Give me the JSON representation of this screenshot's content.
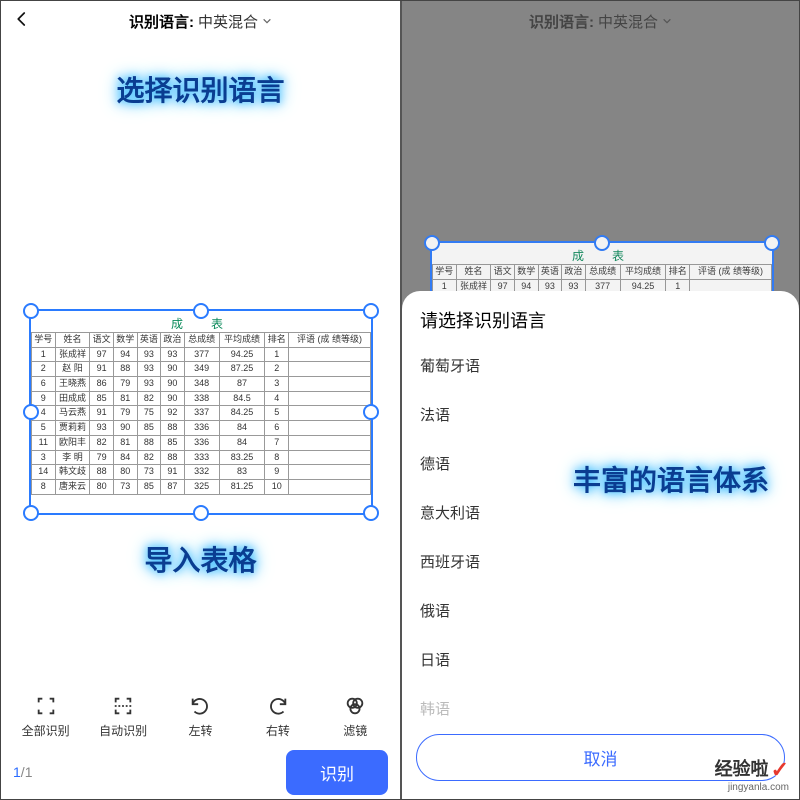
{
  "header": {
    "label": "识别语言:",
    "value": "中英混合"
  },
  "annotations": {
    "select_language": "选择识别语言",
    "import_table": "导入表格",
    "rich_languages": "丰富的语言体系"
  },
  "table": {
    "title": "成　表",
    "columns": [
      "学号",
      "姓名",
      "语文",
      "数学",
      "英语",
      "政治",
      "总成绩",
      "平均成绩",
      "排名",
      "评语 (成\n绩等级)"
    ],
    "rows": [
      [
        "1",
        "张成祥",
        "97",
        "94",
        "93",
        "93",
        "377",
        "94.25",
        "1",
        ""
      ],
      [
        "2",
        "赵 阳",
        "91",
        "88",
        "93",
        "90",
        "349",
        "87.25",
        "2",
        ""
      ],
      [
        "6",
        "王晓燕",
        "86",
        "79",
        "93",
        "90",
        "348",
        "87",
        "3",
        ""
      ],
      [
        "9",
        "田成成",
        "85",
        "81",
        "82",
        "90",
        "338",
        "84.5",
        "4",
        ""
      ],
      [
        "4",
        "马云燕",
        "91",
        "79",
        "75",
        "92",
        "337",
        "84.25",
        "5",
        ""
      ],
      [
        "5",
        "贾莉莉",
        "93",
        "90",
        "85",
        "88",
        "336",
        "84",
        "6",
        ""
      ],
      [
        "11",
        "欧阳丰",
        "82",
        "81",
        "88",
        "85",
        "336",
        "84",
        "7",
        ""
      ],
      [
        "3",
        "李 明",
        "79",
        "84",
        "82",
        "88",
        "333",
        "83.25",
        "8",
        ""
      ],
      [
        "14",
        "韩文歧",
        "88",
        "80",
        "73",
        "91",
        "332",
        "83",
        "9",
        ""
      ],
      [
        "8",
        "唐来云",
        "80",
        "73",
        "85",
        "87",
        "325",
        "81.25",
        "10",
        ""
      ]
    ]
  },
  "toolbar": {
    "full_recognize": "全部识别",
    "auto_recognize": "自动识别",
    "rotate_left": "左转",
    "rotate_right": "右转",
    "filter": "滤镜"
  },
  "footer": {
    "page_current": "1",
    "page_sep": "/",
    "page_total": "1",
    "recognize_button": "识别"
  },
  "sheet": {
    "title": "请选择识别语言",
    "options": [
      "葡萄牙语",
      "法语",
      "德语",
      "意大利语",
      "西班牙语",
      "俄语",
      "日语",
      "韩语"
    ],
    "cancel": "取消"
  },
  "watermark": {
    "text": "经验啦",
    "url": "jingyanla.com"
  }
}
